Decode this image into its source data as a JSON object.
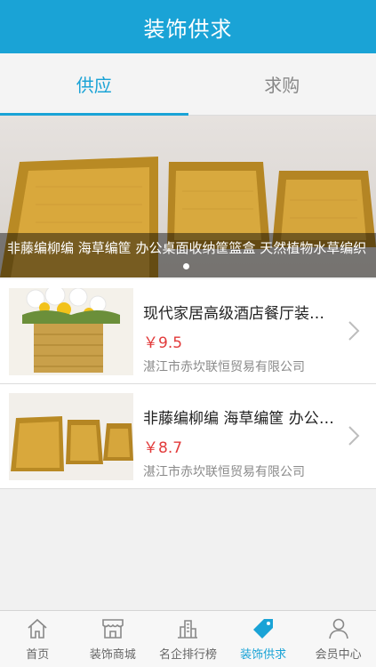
{
  "header": {
    "title": "装饰供求"
  },
  "tabs": [
    {
      "label": "供应",
      "active": true
    },
    {
      "label": "求购",
      "active": false
    }
  ],
  "banner": {
    "caption": "非藤编柳编 海草编筐 办公桌面收纳筐篮盒 天然植物水草编织",
    "dots": 1
  },
  "products": [
    {
      "name": "现代家居高级酒店餐厅装饰花盆",
      "price": "￥9.5",
      "company": "湛江市赤坎联恒贸易有限公司"
    },
    {
      "name": "非藤编柳编 海草编筐 办公桌面收纳筐篮盒",
      "price": "￥8.7",
      "company": "湛江市赤坎联恒贸易有限公司"
    }
  ],
  "tabbar": [
    {
      "label": "首页",
      "icon": "home-icon",
      "active": false
    },
    {
      "label": "装饰商城",
      "icon": "store-icon",
      "active": false
    },
    {
      "label": "名企排行榜",
      "icon": "building-icon",
      "active": false
    },
    {
      "label": "装饰供求",
      "icon": "tag-icon",
      "active": true
    },
    {
      "label": "会员中心",
      "icon": "user-icon",
      "active": false
    }
  ],
  "colors": {
    "accent": "#1aa3d6",
    "price": "#e23b3b"
  }
}
